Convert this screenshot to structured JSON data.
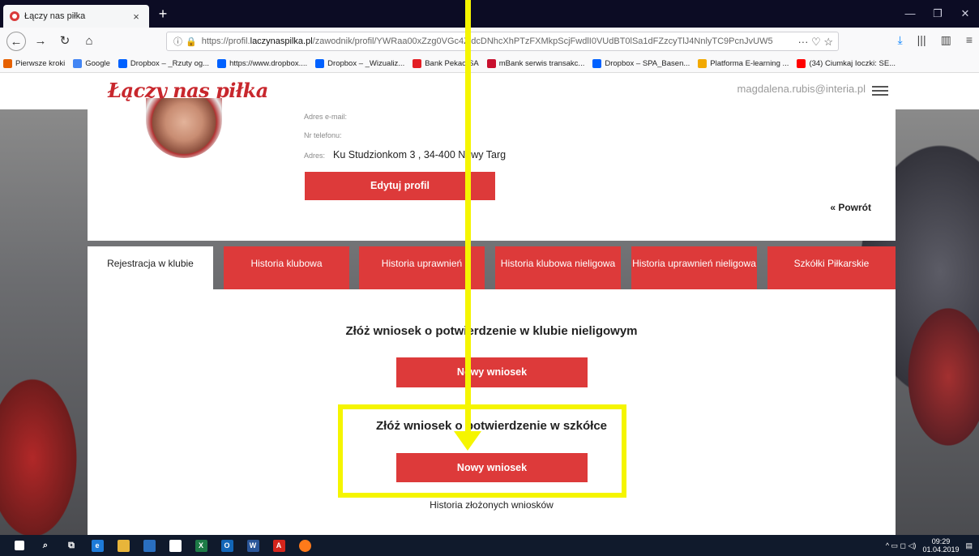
{
  "browser": {
    "tab_title": "Łączy nas piłka",
    "tab_close": "×",
    "new_tab": "+",
    "url_prefix": "https://profil.",
    "url_host": "laczynaspilka.pl",
    "url_path": "/zawodnik/profil/YWRaa00xZzg0VGc4ZldcDNhcXhPTzFXMkpScjFwdlI0VUdBT0lSa1dFZzcyTlJ4NnlyTC9PcnJvUW5",
    "page_actions": "··· ♡ ☆",
    "window_controls": [
      "—",
      "❐",
      "✕"
    ]
  },
  "bookmarks": [
    {
      "label": "Pierwsze kroki",
      "color": "#e66000"
    },
    {
      "label": "Google",
      "color": "#4285f4"
    },
    {
      "label": "Dropbox – _Rzuty og...",
      "color": "#0061ff"
    },
    {
      "label": "https://www.dropbox....",
      "color": "#0061ff"
    },
    {
      "label": "Dropbox – _Wizualiz...",
      "color": "#0061ff"
    },
    {
      "label": "Bank Pekao SA",
      "color": "#e31e24"
    },
    {
      "label": "mBank serwis transakc...",
      "color": "#c8102e"
    },
    {
      "label": "Dropbox – SPA_Basen...",
      "color": "#0061ff"
    },
    {
      "label": "Platforma E-learning ...",
      "color": "#f2a900"
    },
    {
      "label": "(34) Ciumkaj Ioczki: SE...",
      "color": "#ff0000"
    }
  ],
  "site": {
    "logo": "Łączy nas piłka",
    "user_email": "magdalena.rubis@interia.pl"
  },
  "profile": {
    "email_label": "Adres e-mail:",
    "phone_label": "Nr telefonu:",
    "address_label": "Adres:",
    "address_value": "Ku Studzionkom 3 , 34-400 Nowy Targ",
    "edit_button": "Edytuj profil",
    "back_link": "« Powrót"
  },
  "tabs": [
    {
      "label": "Rejestracja w klubie",
      "active": true
    },
    {
      "label": "Historia klubowa",
      "active": false
    },
    {
      "label": "Historia uprawnień",
      "active": false
    },
    {
      "label": "Historia klubowa nieligowa",
      "active": false
    },
    {
      "label": "Historia uprawnień nieligowa",
      "active": false
    },
    {
      "label": "Szkółki Piłkarskie",
      "active": false
    }
  ],
  "sections": {
    "club_title": "Złóż wniosek o potwierdzenie w klubie nieligowym",
    "club_button": "Nowy wniosek",
    "school_title": "Złóż wniosek o potwierdzenie w szkółce",
    "school_button": "Nowy wniosek",
    "history_link": "Historia złożonych wniosków"
  },
  "annotation": {
    "color": "#f5f500"
  },
  "taskbar": {
    "time": "09:29",
    "date": "01.04.2019"
  }
}
